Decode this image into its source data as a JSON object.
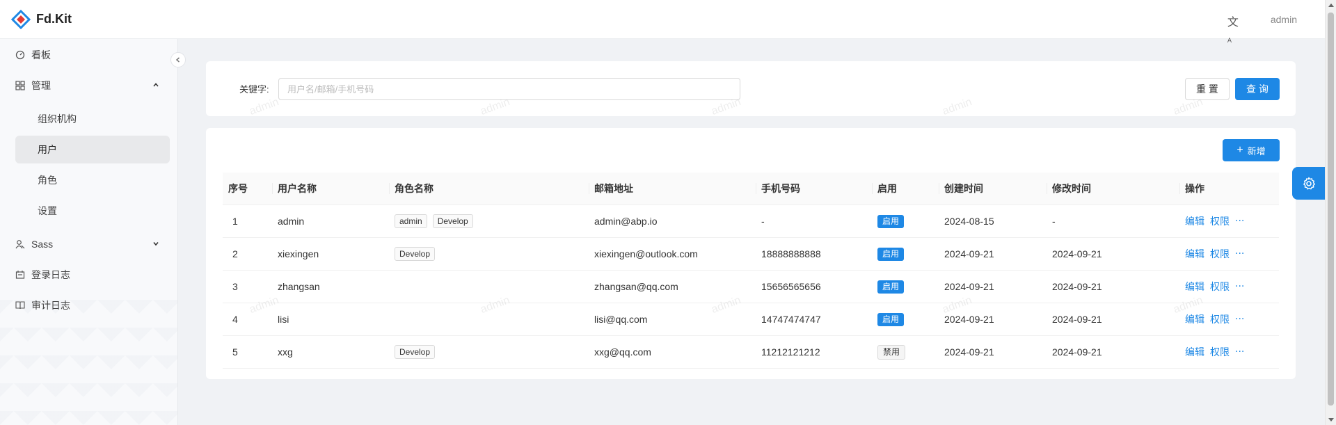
{
  "brand": {
    "name": "Fd.Kit"
  },
  "header": {
    "translate_icon": "translate-icon",
    "user": "admin"
  },
  "sidebar": {
    "dashboard": "看板",
    "manage": "管理",
    "manage_children": [
      "组织机构",
      "用户",
      "角色",
      "设置"
    ],
    "sass": "Sass",
    "login_log": "登录日志",
    "audit_log": "审计日志"
  },
  "search": {
    "keyword_label": "关键字:",
    "keyword_placeholder": "用户名/邮箱/手机号码",
    "keyword_value": "",
    "reset_label": "重 置",
    "query_label": "查 询"
  },
  "toolbar": {
    "add_label": "新增"
  },
  "table": {
    "columns": [
      "序号",
      "用户名称",
      "角色名称",
      "邮箱地址",
      "手机号码",
      "启用",
      "创建时间",
      "修改时间",
      "操作"
    ],
    "rows": [
      {
        "no": "1",
        "name": "admin",
        "roles": [
          "admin",
          "Develop"
        ],
        "email": "admin@abp.io",
        "phone": "-",
        "status": "启用",
        "created": "2024-08-15",
        "modified": "-",
        "enabled": true
      },
      {
        "no": "2",
        "name": "xiexingen",
        "roles": [
          "Develop"
        ],
        "email": "xiexingen@outlook.com",
        "phone": "18888888888",
        "status": "启用",
        "created": "2024-09-21",
        "modified": "2024-09-21",
        "enabled": true
      },
      {
        "no": "3",
        "name": "zhangsan",
        "roles": [],
        "email": "zhangsan@qq.com",
        "phone": "15656565656",
        "status": "启用",
        "created": "2024-09-21",
        "modified": "2024-09-21",
        "enabled": true
      },
      {
        "no": "4",
        "name": "lisi",
        "roles": [],
        "email": "lisi@qq.com",
        "phone": "14747474747",
        "status": "启用",
        "created": "2024-09-21",
        "modified": "2024-09-21",
        "enabled": true
      },
      {
        "no": "5",
        "name": "xxg",
        "roles": [
          "Develop"
        ],
        "email": "xxg@qq.com",
        "phone": "11212121212",
        "status": "禁用",
        "created": "2024-09-21",
        "modified": "2024-09-21",
        "enabled": false
      }
    ],
    "actions": {
      "edit": "编辑",
      "permission": "权限",
      "more": "···"
    }
  },
  "watermark": "admin",
  "colors": {
    "primary": "#1e88e5"
  }
}
